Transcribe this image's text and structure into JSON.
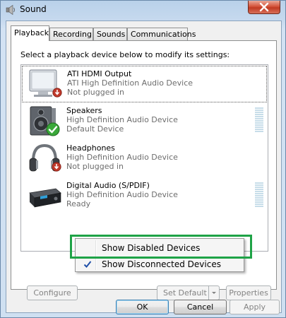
{
  "window": {
    "title": "Sound",
    "close_label": "×"
  },
  "tabs": [
    {
      "label": "Playback",
      "active": true
    },
    {
      "label": "Recording",
      "active": false
    },
    {
      "label": "Sounds",
      "active": false
    },
    {
      "label": "Communications",
      "active": false
    }
  ],
  "instruction": "Select a playback device below to modify its settings:",
  "devices": [
    {
      "name": "ATI HDMI Output",
      "driver": "ATI High Definition Audio Device",
      "status": "Not plugged in",
      "icon": "monitor-icon",
      "badge": "unplugged-badge"
    },
    {
      "name": "Speakers",
      "driver": "High Definition Audio Device",
      "status": "Default Device",
      "icon": "speaker-icon",
      "badge": "default-check-badge"
    },
    {
      "name": "Headphones",
      "driver": "High Definition Audio Device",
      "status": "Not plugged in",
      "icon": "headphones-icon",
      "badge": "unplugged-badge"
    },
    {
      "name": "Digital Audio (S/PDIF)",
      "driver": "High Definition Audio Device",
      "status": "Ready",
      "icon": "digital-audio-receiver-icon",
      "badge": ""
    }
  ],
  "context_menu": {
    "items": [
      {
        "label": "Show Disabled Devices",
        "checked": false
      },
      {
        "label": "Show Disconnected Devices",
        "checked": true
      }
    ]
  },
  "buttons": {
    "configure": "Configure",
    "set_default": "Set Default",
    "properties": "Properties",
    "ok": "OK",
    "cancel": "Cancel",
    "apply": "Apply"
  },
  "colors": {
    "highlight_box": "#1fa347",
    "check_badge": "#3aa83a",
    "unplugged_badge": "#c0392b",
    "menu_check": "#1f4fa8"
  }
}
